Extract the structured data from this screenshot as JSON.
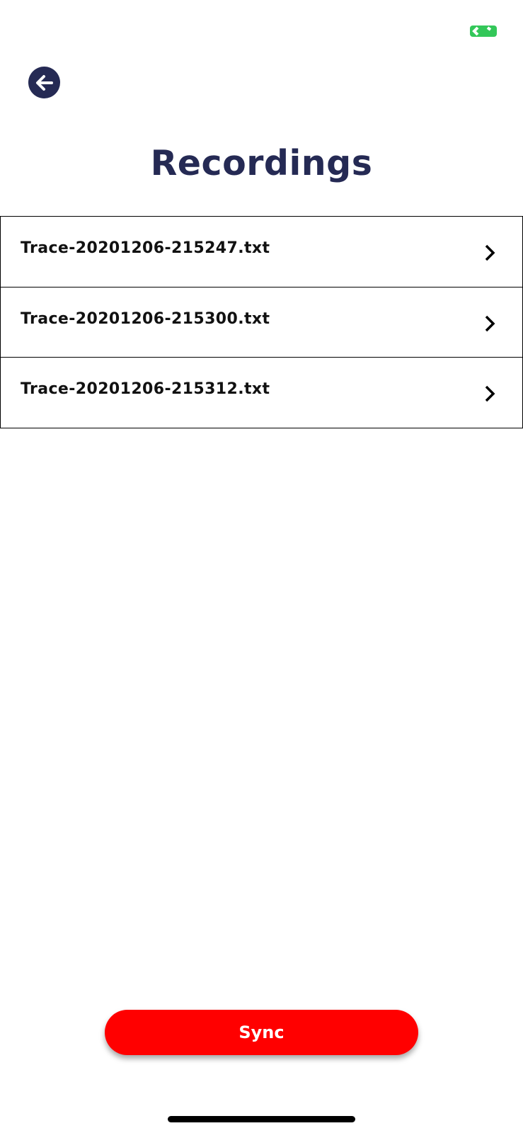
{
  "status_bar": {
    "indicator_icon": "switch-indicator-icon",
    "indicator_color": "#33c759"
  },
  "header": {
    "back_icon": "arrow-left-icon",
    "title": "Recordings",
    "title_color": "#252a54"
  },
  "recordings": {
    "items": [
      {
        "label": "Trace-20201206-215247.txt",
        "icon": "chevron-right-icon"
      },
      {
        "label": "Trace-20201206-215300.txt",
        "icon": "chevron-right-icon"
      },
      {
        "label": "Trace-20201206-215312.txt",
        "icon": "chevron-right-icon"
      }
    ]
  },
  "footer": {
    "sync_label": "Sync",
    "sync_color": "#ff0000"
  }
}
